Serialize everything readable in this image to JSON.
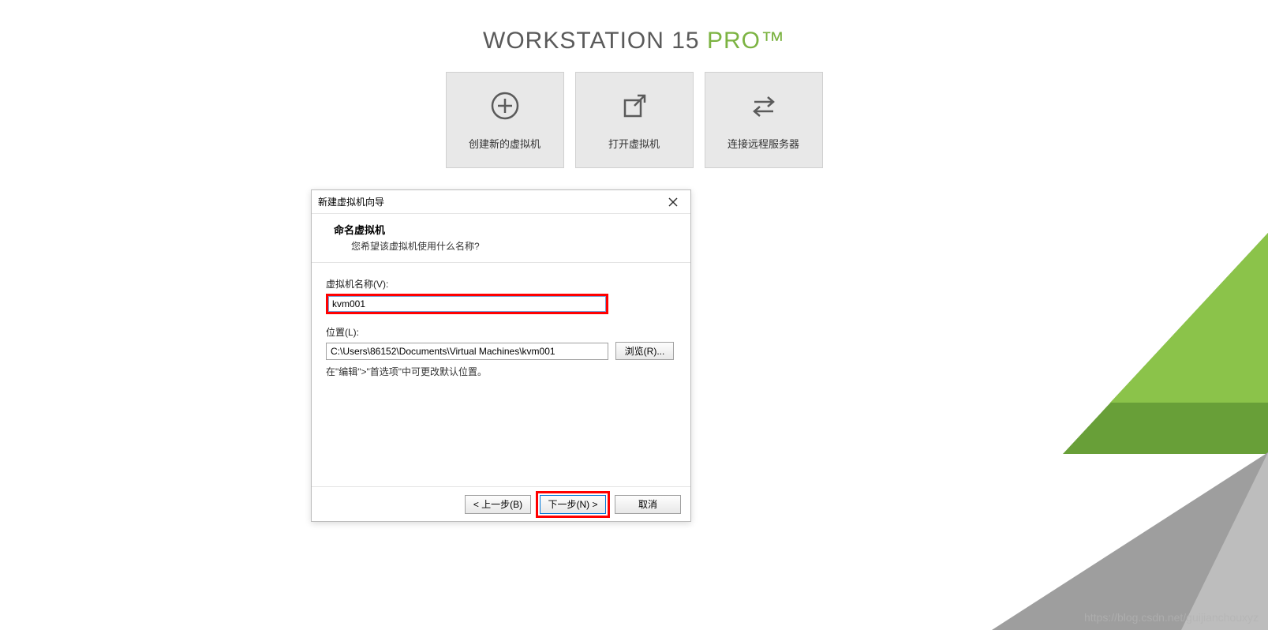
{
  "app": {
    "title_part1": "WORKSTATION 15 ",
    "title_part2": "PRO",
    "title_tm": "™"
  },
  "tiles": {
    "create": "创建新的虚拟机",
    "open": "打开虚拟机",
    "connect": "连接远程服务器"
  },
  "dialog": {
    "title": "新建虚拟机向导",
    "heading": "命名虚拟机",
    "subheading": "您希望该虚拟机使用什么名称?",
    "name_label": "虚拟机名称(V):",
    "name_value": "kvm001",
    "location_label": "位置(L):",
    "location_value": "C:\\Users\\86152\\Documents\\Virtual Machines\\kvm001",
    "browse_button": "浏览(R)...",
    "hint": "在\"编辑\">\"首选项\"中可更改默认位置。",
    "back_button": "< 上一步(B)",
    "next_button": "下一步(N) >",
    "cancel_button": "取消"
  },
  "watermark": "https://blog.csdn.net/guijianchouxyz"
}
